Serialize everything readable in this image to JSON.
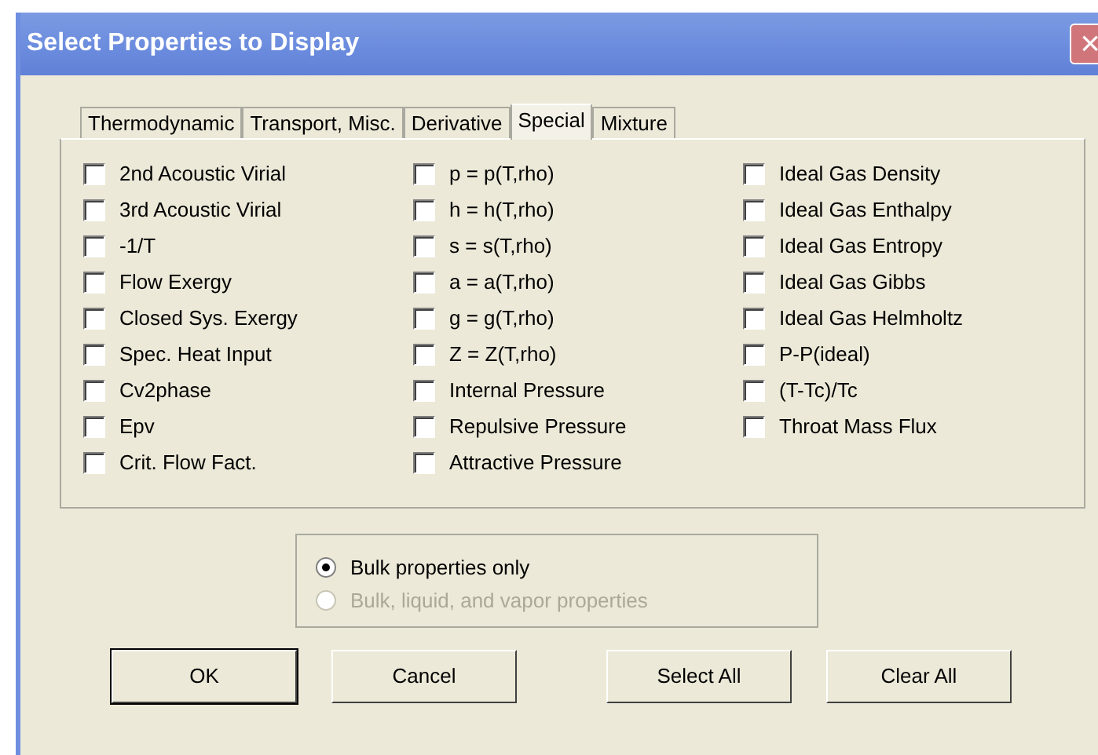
{
  "window": {
    "title": "Select Properties to Display",
    "close": "×"
  },
  "tabs": [
    {
      "label": "Thermodynamic",
      "selected": false
    },
    {
      "label": "Transport, Misc.",
      "selected": false
    },
    {
      "label": "Derivative",
      "selected": false
    },
    {
      "label": "Special",
      "selected": true
    },
    {
      "label": "Mixture",
      "selected": false
    }
  ],
  "columns": [
    [
      {
        "label": "2nd Acoustic Virial",
        "checked": false
      },
      {
        "label": "3rd Acoustic Virial",
        "checked": false
      },
      {
        "label": "-1/T",
        "checked": false
      },
      {
        "label": "Flow Exergy",
        "checked": false
      },
      {
        "label": "Closed Sys. Exergy",
        "checked": false
      },
      {
        "label": "Spec. Heat Input",
        "checked": false
      },
      {
        "label": "Cv2phase",
        "checked": false
      },
      {
        "label": "Epv",
        "checked": false
      },
      {
        "label": "Crit. Flow Fact.",
        "checked": false
      }
    ],
    [
      {
        "label": "p = p(T,rho)",
        "checked": false
      },
      {
        "label": "h = h(T,rho)",
        "checked": false
      },
      {
        "label": "s = s(T,rho)",
        "checked": false
      },
      {
        "label": "a = a(T,rho)",
        "checked": false
      },
      {
        "label": "g = g(T,rho)",
        "checked": false
      },
      {
        "label": "Z = Z(T,rho)",
        "checked": false
      },
      {
        "label": "Internal Pressure",
        "checked": false
      },
      {
        "label": "Repulsive Pressure",
        "checked": false
      },
      {
        "label": "Attractive Pressure",
        "checked": false
      }
    ],
    [
      {
        "label": "Ideal Gas Density",
        "checked": false
      },
      {
        "label": "Ideal Gas Enthalpy",
        "checked": false
      },
      {
        "label": "Ideal Gas Entropy",
        "checked": false
      },
      {
        "label": "Ideal Gas Gibbs",
        "checked": false
      },
      {
        "label": "Ideal Gas Helmholtz",
        "checked": false
      },
      {
        "label": "P-P(ideal)",
        "checked": false
      },
      {
        "label": "(T-Tc)/Tc",
        "checked": false
      },
      {
        "label": "Throat Mass Flux",
        "checked": false
      }
    ]
  ],
  "radios": [
    {
      "label": "Bulk properties only",
      "selected": true,
      "disabled": false
    },
    {
      "label": "Bulk, liquid, and vapor properties",
      "selected": false,
      "disabled": true
    }
  ],
  "buttons": [
    {
      "label": "OK",
      "default": true
    },
    {
      "label": "Cancel",
      "default": false
    },
    {
      "label": "Select All",
      "default": false
    },
    {
      "label": "Clear All",
      "default": false
    }
  ]
}
